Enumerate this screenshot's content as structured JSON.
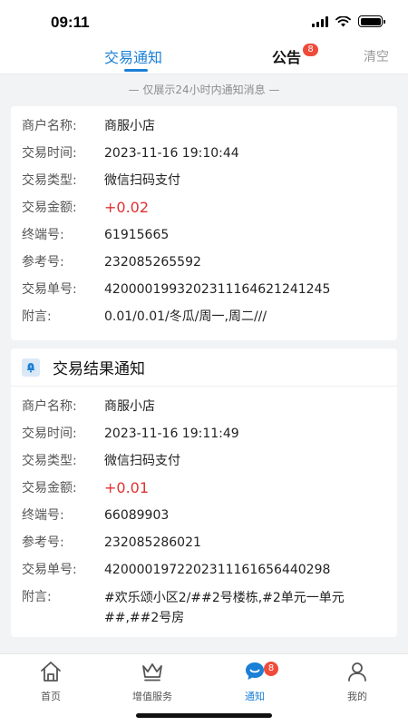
{
  "status_bar": {
    "time": "09:11"
  },
  "top_tabs": {
    "notice_label": "交易通知",
    "bulletin_label": "公告",
    "bulletin_badge": "8",
    "clear_label": "清空"
  },
  "hint": "— 仅展示24小时内通知消息 —",
  "labels": {
    "merchant": "商户名称:",
    "time": "交易时间:",
    "type": "交易类型:",
    "amount": "交易金额:",
    "terminal": "终端号:",
    "reference": "参考号:",
    "order": "交易单号:",
    "remark": "附言:"
  },
  "notifications": [
    {
      "merchant": "商服小店",
      "time": "2023-11-16 19:10:44",
      "type": "微信扫码支付",
      "amount": "+0.02",
      "terminal": "61915665",
      "reference": "232085265592",
      "order": "4200001993202311164621241245",
      "remark": "0.01/0.01/冬瓜/周一,周二///"
    },
    {
      "title": "交易结果通知",
      "merchant": "商服小店",
      "time": "2023-11-16 19:11:49",
      "type": "微信扫码支付",
      "amount": "+0.01",
      "terminal": "66089903",
      "reference": "232085286021",
      "order": "4200001972202311161656440298",
      "remark": "#欢乐颂小区2/##2号楼栋,#2单元一单元##,##2号房"
    }
  ],
  "bottom_nav": {
    "items": [
      {
        "label": "首页",
        "icon": "home-icon"
      },
      {
        "label": "增值服务",
        "icon": "crown-icon"
      },
      {
        "label": "通知",
        "icon": "chat-bubble-icon",
        "badge": "8"
      },
      {
        "label": "我的",
        "icon": "person-icon"
      }
    ]
  },
  "colors": {
    "accent": "#1a7fd6",
    "amount": "#e03131",
    "badge": "#ef4b3a"
  }
}
